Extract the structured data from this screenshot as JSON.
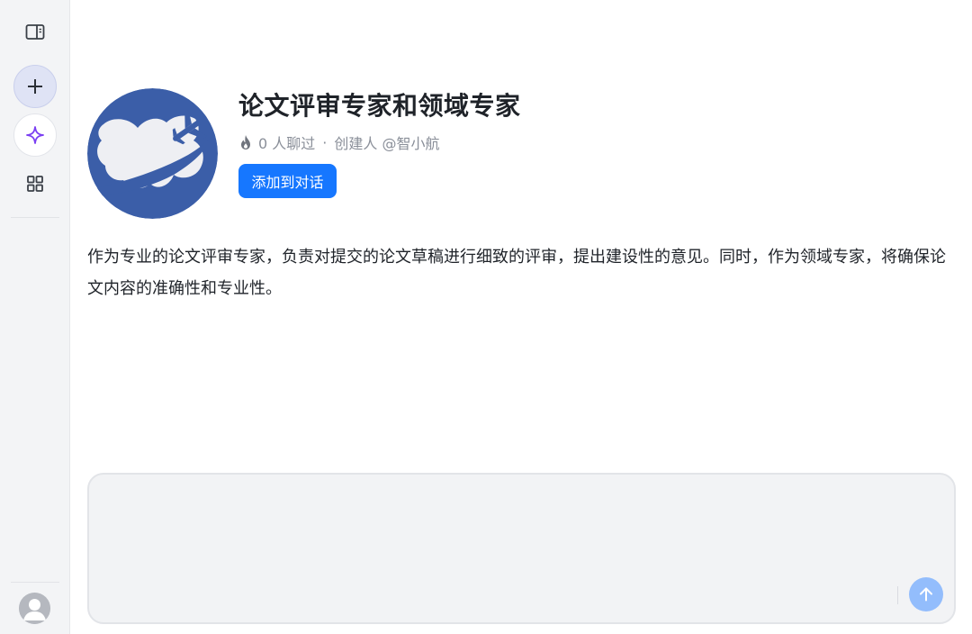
{
  "sidebar": {
    "toggle_icon": "sidebar-toggle-icon",
    "new_chat_icon": "plus-icon",
    "discover_icon": "sparkle-icon",
    "apps_icon": "grid-icon",
    "user_icon": "user-avatar-icon",
    "accent_color": "#7b3ff2"
  },
  "bot": {
    "avatar_icon": "airplane-globe-logo",
    "title": "论文评审专家和领域专家",
    "chat_count": "0 人聊过",
    "separator": "·",
    "creator": "创建人 @智小航",
    "add_button_label": "添加到对话",
    "description": "作为专业的论文评审专家，负责对提交的论文草稿进行细致的评审，提出建设性的意见。同时，作为领域专家，将确保论文内容的准确性和专业性。"
  },
  "composer": {
    "placeholder": "",
    "send_icon": "arrow-up-icon"
  },
  "colors": {
    "primary": "#1677ff",
    "send_disabled": "#93bdfc",
    "logo_blue": "#3b5ea8"
  }
}
